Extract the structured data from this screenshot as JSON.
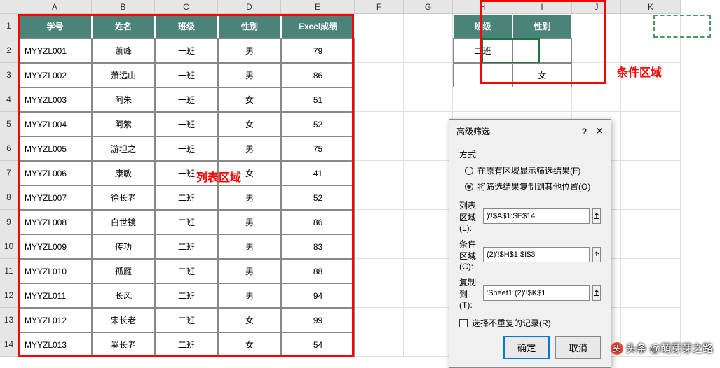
{
  "columns": [
    "A",
    "B",
    "C",
    "D",
    "E",
    "F",
    "G",
    "H",
    "I",
    "J",
    "K"
  ],
  "rows": [
    "1",
    "2",
    "3",
    "4",
    "5",
    "6",
    "7",
    "8",
    "9",
    "10",
    "11",
    "12",
    "13",
    "14"
  ],
  "main_table": {
    "headers": [
      "学号",
      "姓名",
      "班级",
      "性别",
      "Excel成绩"
    ],
    "data": [
      [
        "MYYZL001",
        "萧峰",
        "一班",
        "男",
        "79"
      ],
      [
        "MYYZL002",
        "萧远山",
        "一班",
        "男",
        "86"
      ],
      [
        "MYYZL003",
        "阿朱",
        "一班",
        "女",
        "51"
      ],
      [
        "MYYZL004",
        "阿紫",
        "一班",
        "女",
        "52"
      ],
      [
        "MYYZL005",
        "游坦之",
        "一班",
        "男",
        "75"
      ],
      [
        "MYYZL006",
        "康敏",
        "一班",
        "女",
        "41"
      ],
      [
        "MYYZL007",
        "徐长老",
        "二班",
        "男",
        "52"
      ],
      [
        "MYYZL008",
        "白世镜",
        "二班",
        "男",
        "86"
      ],
      [
        "MYYZL009",
        "传功",
        "二班",
        "男",
        "83"
      ],
      [
        "MYYZL010",
        "孤雁",
        "二班",
        "男",
        "88"
      ],
      [
        "MYYZL011",
        "长风",
        "二班",
        "男",
        "94"
      ],
      [
        "MYYZL012",
        "宋长老",
        "二班",
        "女",
        "99"
      ],
      [
        "MYYZL013",
        "奚长老",
        "二班",
        "女",
        "54"
      ]
    ]
  },
  "criteria_table": {
    "headers": [
      "班级",
      "性别"
    ],
    "row2": [
      "二班",
      ""
    ],
    "row3": [
      "",
      "女"
    ]
  },
  "annotations": {
    "list_area": "列表区域",
    "criteria_area": "条件区域"
  },
  "dialog": {
    "title": "高级筛选",
    "help": "?",
    "close": "✕",
    "method_label": "方式",
    "radio1": "在原有区域显示筛选结果(F)",
    "radio2": "将筛选结果复制到其他位置(O)",
    "field_list_label": "列表区域(L):",
    "field_list_value": ")'!$A$1:$E$14",
    "field_criteria_label": "条件区域(C):",
    "field_criteria_value": "(2)'!$H$1:$I$3",
    "field_copy_label": "复制到(T):",
    "field_copy_value": "'Sheet1 (2)'!$K$1",
    "checkbox_label": "选择不重复的记录(R)",
    "ok": "确定",
    "cancel": "取消"
  },
  "watermark": "头条 @萌芽芽之路"
}
